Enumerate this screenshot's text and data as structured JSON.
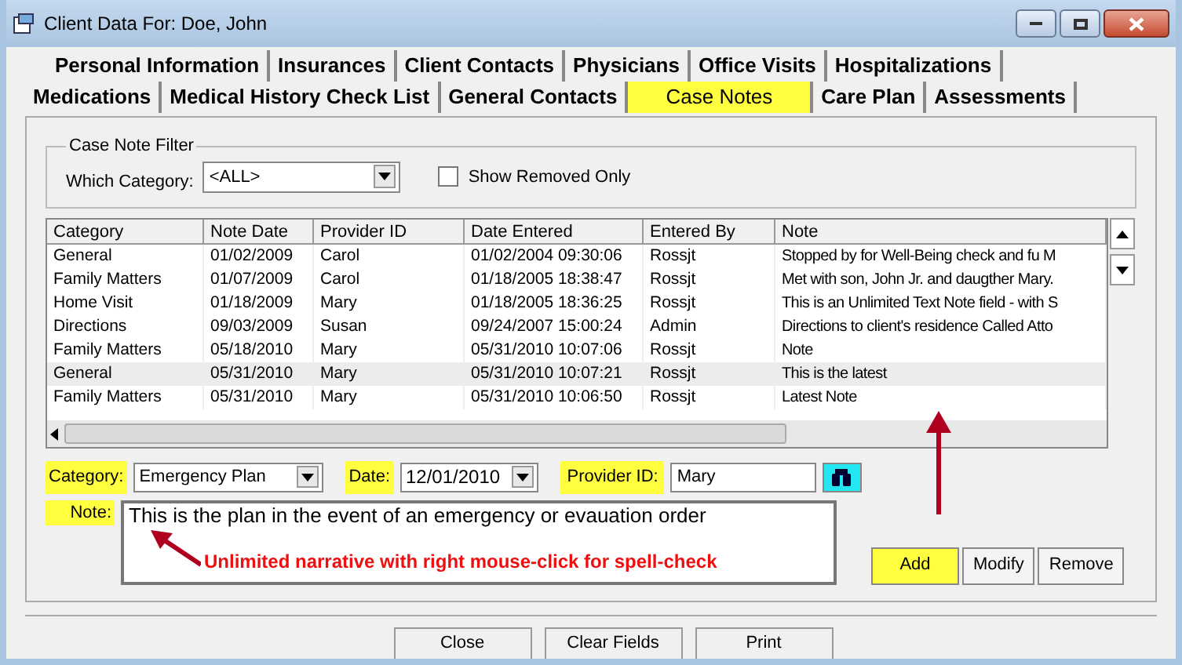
{
  "window": {
    "title": "Client Data For: Doe, John"
  },
  "tab_rows": [
    [
      {
        "label": "Personal Information",
        "selected": false
      },
      {
        "label": "Insurances",
        "selected": false
      },
      {
        "label": "Client Contacts",
        "selected": false
      },
      {
        "label": "Physicians",
        "selected": false
      },
      {
        "label": "Office Visits",
        "selected": false
      },
      {
        "label": "Hospitalizations",
        "selected": false
      }
    ],
    [
      {
        "label": "Medications",
        "selected": false
      },
      {
        "label": "Medical History Check List",
        "selected": false
      },
      {
        "label": "General Contacts",
        "selected": false
      },
      {
        "label": "Case Notes",
        "selected": true
      },
      {
        "label": "Care Plan",
        "selected": false
      },
      {
        "label": "Assessments",
        "selected": false
      }
    ]
  ],
  "filter": {
    "title": "Case Note Filter",
    "category_label": "Which Category:",
    "category_value": "<ALL>",
    "show_removed": {
      "label": "Show Removed Only",
      "checked": false
    }
  },
  "table": {
    "columns": [
      "Category",
      "Note Date",
      "Provider ID",
      "Date Entered",
      "Entered By",
      "Note"
    ],
    "rows": [
      {
        "cells": [
          "General",
          "01/02/2009",
          "Carol",
          "01/02/2004 09:30:06",
          "Rossjt",
          "Stopped by for Well-Being check and fu M"
        ],
        "selected": false
      },
      {
        "cells": [
          "Family Matters",
          "01/07/2009",
          "Carol",
          "01/18/2005 18:38:47",
          "Rossjt",
          "Met with son, John Jr. and daugther Mary."
        ],
        "selected": false
      },
      {
        "cells": [
          "Home Visit",
          "01/18/2009",
          "Mary",
          "01/18/2005 18:36:25",
          "Rossjt",
          "This is an Unlimited Text Note field - with S"
        ],
        "selected": false
      },
      {
        "cells": [
          "Directions",
          "09/03/2009",
          "Susan",
          "09/24/2007 15:00:24",
          "Admin",
          "Directions to client's residence Called Atto"
        ],
        "selected": false
      },
      {
        "cells": [
          "Family Matters",
          "05/18/2010",
          "Mary",
          "05/31/2010 10:07:06",
          "Rossjt",
          "Note"
        ],
        "selected": false
      },
      {
        "cells": [
          "General",
          "05/31/2010",
          "Mary",
          "05/31/2010 10:07:21",
          "Rossjt",
          "This is the latest"
        ],
        "selected": true
      },
      {
        "cells": [
          "Family Matters",
          "05/31/2010",
          "Mary",
          "05/31/2010 10:06:50",
          "Rossjt",
          "Latest Note"
        ],
        "selected": false
      }
    ]
  },
  "form": {
    "category": {
      "label": "Category:",
      "value": "Emergency Plan",
      "highlighted": true
    },
    "date": {
      "label": "Date:",
      "value": "12/01/2010",
      "highlighted": true
    },
    "provider": {
      "label": "Provider ID:",
      "value": "Mary",
      "highlighted": true
    },
    "note": {
      "label": "Note:",
      "value": "This is the plan in the event of an emergency or evauation order",
      "highlighted": true
    },
    "annotation": "Unlimited narrative with right mouse-click for spell-check",
    "buttons": [
      {
        "label": "Add",
        "highlighted": true
      },
      {
        "label": "Modify",
        "highlighted": false
      },
      {
        "label": "Remove",
        "highlighted": false
      }
    ]
  },
  "footer_buttons": [
    "Close",
    "Clear Fields",
    "Print"
  ]
}
